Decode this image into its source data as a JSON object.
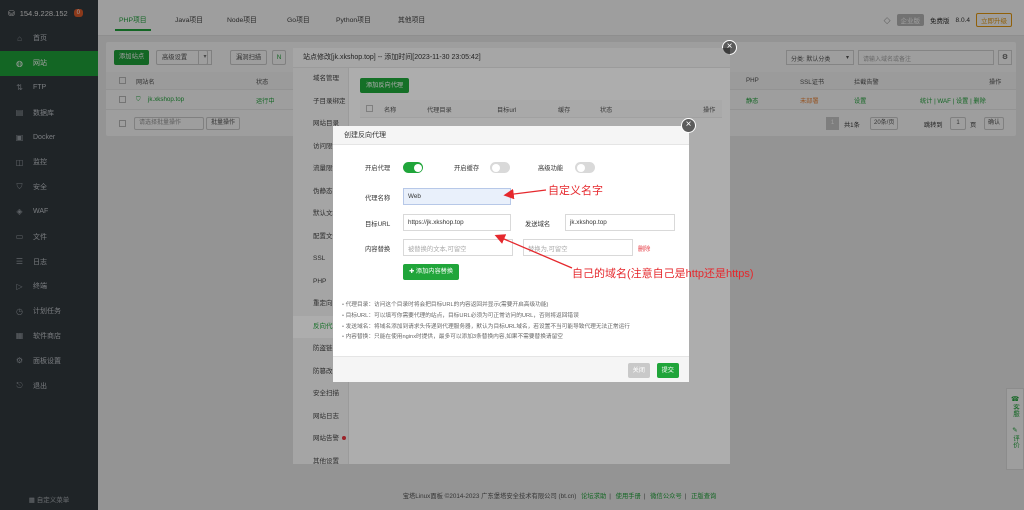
{
  "sidebar": {
    "server": "154.9.228.152",
    "badge": "0",
    "items": [
      {
        "icon": "home-icon",
        "glyph": "⌂",
        "label": "首页"
      },
      {
        "icon": "globe-icon",
        "glyph": "◍",
        "label": "网站",
        "active": true
      },
      {
        "icon": "ftp-icon",
        "glyph": "⇅",
        "label": "FTP"
      },
      {
        "icon": "database-icon",
        "glyph": "▤",
        "label": "数据库"
      },
      {
        "icon": "docker-icon",
        "glyph": "▣",
        "label": "Docker"
      },
      {
        "icon": "monitor-icon",
        "glyph": "◫",
        "label": "监控"
      },
      {
        "icon": "shield-icon",
        "glyph": "⛉",
        "label": "安全"
      },
      {
        "icon": "waf-icon",
        "glyph": "◈",
        "label": "WAF"
      },
      {
        "icon": "folder-icon",
        "glyph": "▭",
        "label": "文件"
      },
      {
        "icon": "log-icon",
        "glyph": "☰",
        "label": "日志"
      },
      {
        "icon": "terminal-icon",
        "glyph": "▷",
        "label": "终端"
      },
      {
        "icon": "clock-icon",
        "glyph": "◷",
        "label": "计划任务"
      },
      {
        "icon": "store-icon",
        "glyph": "▦",
        "label": "软件商店"
      },
      {
        "icon": "settings-icon",
        "glyph": "⚙",
        "label": "面板设置"
      },
      {
        "icon": "logout-icon",
        "glyph": "⎋",
        "label": "退出"
      }
    ],
    "footer": "自定义菜单"
  },
  "topbar": {
    "tabs": [
      "PHP项目",
      "Java项目",
      "Node项目",
      "Go项目",
      "Python项目",
      "其他项目"
    ],
    "enterprise": "企业版",
    "free_label": "免费版",
    "version": "8.0.4",
    "upgrade": "立即升级"
  },
  "main": {
    "add_site": "添加站点",
    "advanced": "高级设置",
    "hidden_scan": "漏洞扫描",
    "sort": "分类: 默认分类",
    "search_placeholder": "请输入域名或备注",
    "columns": {
      "name": "网站名",
      "status": "状态",
      "php": "PHP",
      "ssl": "SSL证书",
      "alert": "拦截告警",
      "ops": "操作"
    },
    "row": {
      "name": "jk.xkshop.top",
      "status": "运行中",
      "php": "静态",
      "ssl": "未部署",
      "alert": "设置",
      "ops": "统计 | WAF | 设置 | 删除"
    },
    "batch_placeholder": "请选择批量操作",
    "batch_btn": "批量操作",
    "pager": {
      "page": "1",
      "total": "共1条",
      "per_page": "20条/页",
      "goto": "跳转到",
      "goto_value": "1",
      "page_unit": "页",
      "confirm": "确认"
    }
  },
  "outer_dialog": {
    "title": "站点修改[jk.xkshop.top] -- 添加时间[2023-11-30 23:05:42]",
    "menu": [
      "域名管理",
      "子目录绑定",
      "网站目录",
      "访问限制",
      "流量限制",
      "伪静态",
      "默认文档",
      "配置文件",
      "SSL",
      "PHP",
      "重定向",
      "反向代理",
      "防盗链",
      "防篡改",
      "安全扫描",
      "网站日志",
      "网站告警",
      "其他设置"
    ],
    "add_proxy": "添加反向代理",
    "cols": [
      "名称",
      "代理目录",
      "目标url",
      "缓存",
      "状态",
      "操作"
    ]
  },
  "inner_dialog": {
    "title": "创建反向代理",
    "enable_proxy": "开启代理",
    "enable_cache": "开启缓存",
    "advanced": "高级功能",
    "proxy_name_label": "代理名称",
    "proxy_name_value": "Web",
    "target_url_label": "目标URL",
    "target_url_value": "https://jk.xkshop.top",
    "send_domain_label": "发送域名",
    "send_domain_value": "jk.xkshop.top",
    "replace_label": "内容替换",
    "replace_from_placeholder": "被替换的文本,可留空",
    "replace_to_placeholder": "替换为,可留空",
    "delete": "删除",
    "add_replace": "添加内容替换",
    "notes": [
      "代理目录：访问这个目录时将会把目标URL的内容返回并显示(需要开启高级功能)",
      "目标URL：可以填写你需要代理的站点，目标URL必须为可正常访问的URL，否则将返回错误",
      "发送域名：将域名添加到请求头传递到代理服务器，默认为目标URL域名，若设置不当可能导致代理无法正常运行",
      "内容替换：只能在使用nginx时提供，最多可以添加3条替换内容,如果不需要替换请留空"
    ],
    "close": "关闭",
    "submit": "提交"
  },
  "annotations": {
    "name_hint": "自定义名字",
    "domain_hint": "自己的域名(注意自己是http还是https)"
  },
  "page_footer": {
    "copyright": "宝塔Linux面板 ©2014-2023 广东堡塔安全技术有限公司 (bt.cn)",
    "links": [
      "论坛求助",
      "使用手册",
      "微信公众号",
      "正版查询"
    ]
  },
  "side_tools": {
    "service": "客服",
    "review": "评价"
  },
  "colors": {
    "accent": "#20a53a",
    "annotation": "#e5282d"
  }
}
